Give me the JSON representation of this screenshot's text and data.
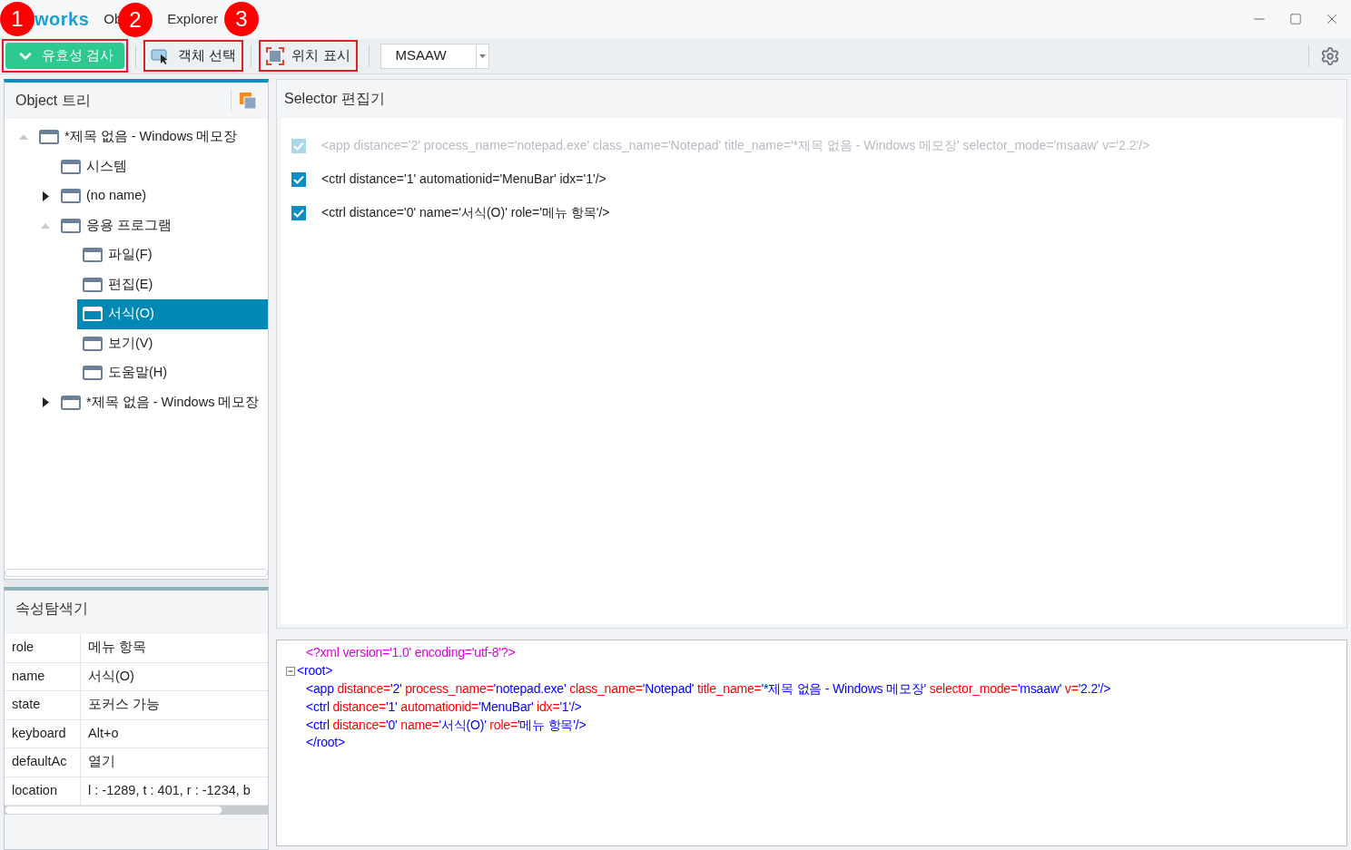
{
  "callouts": [
    "1",
    "2",
    "3"
  ],
  "titlebar": {
    "logo": "works",
    "title_parts": [
      "Ob",
      "Explorer"
    ]
  },
  "toolbar": {
    "validate_button": "유효성 검사",
    "select_button": "객체 선택",
    "locate_button": "위치 표시",
    "mode_dropdown": {
      "value": "MSAAW"
    }
  },
  "object_tree": {
    "title": "Object 트리",
    "items": [
      {
        "label": "*제목 없음 - Windows 메모장",
        "expanded": true,
        "selected": false,
        "children": [
          {
            "label": "시스템",
            "selected": false
          },
          {
            "label": "(no name)",
            "expanded": false,
            "selected": false
          },
          {
            "label": "응용 프로그램",
            "expanded": true,
            "selected": false,
            "children": [
              {
                "label": "파일(F)",
                "selected": false
              },
              {
                "label": "편집(E)",
                "selected": false
              },
              {
                "label": "서식(O)",
                "selected": true
              },
              {
                "label": "보기(V)",
                "selected": false
              },
              {
                "label": "도움말(H)",
                "selected": false
              }
            ]
          },
          {
            "label": "*제목 없음 - Windows 메모장",
            "expanded": false,
            "selected": false
          }
        ]
      }
    ]
  },
  "property_explorer": {
    "title": "속성탐색기",
    "rows": [
      {
        "name": "role",
        "value": "메뉴 항목"
      },
      {
        "name": "name",
        "value": "서식(O)"
      },
      {
        "name": "state",
        "value": "포커스 가능"
      },
      {
        "name": "keyboard",
        "value": "Alt+o"
      },
      {
        "name": "defaultAc",
        "value": "열기"
      },
      {
        "name": "location",
        "value": "l : -1289, t : 401, r : -1234, b"
      }
    ]
  },
  "selector_editor": {
    "title": "Selector 편집기",
    "lines": [
      {
        "text": "<app distance='2' process_name='notepad.exe' class_name='Notepad' title_name='*제목 없음 - Windows 메모장' selector_mode='msaaw' v='2.2'/>",
        "checked": true,
        "disabled": true
      },
      {
        "text": "<ctrl distance='1' automationid='MenuBar' idx='1'/>",
        "checked": true,
        "disabled": false
      },
      {
        "text": "<ctrl distance='0' name='서식(O)' role='메뉴 항목'/>",
        "checked": true,
        "disabled": false
      }
    ]
  },
  "xml_editor": {
    "lines": [
      {
        "kind": "plain",
        "segments": [
          {
            "kind": "pi",
            "text": "<?xml version='1.0' encoding='utf-8'?>"
          }
        ]
      },
      {
        "kind": "foldable",
        "segments": [
          {
            "kind": "tag",
            "text": "<root>"
          }
        ]
      },
      {
        "kind": "plain",
        "segments": [
          {
            "kind": "tag",
            "text": "<app "
          },
          {
            "kind": "attr",
            "text": "distance="
          },
          {
            "kind": "value",
            "text": "'2' "
          },
          {
            "kind": "attr",
            "text": "process_name="
          },
          {
            "kind": "value",
            "text": "'notepad.exe' "
          },
          {
            "kind": "attr",
            "text": "class_name="
          },
          {
            "kind": "value",
            "text": "'Notepad' "
          },
          {
            "kind": "attr",
            "text": "title_name="
          },
          {
            "kind": "value",
            "text": "'*제목 없음 - Windows 메모장' "
          },
          {
            "kind": "attr",
            "text": "selector_mode="
          },
          {
            "kind": "value",
            "text": "'msaaw' "
          },
          {
            "kind": "attr",
            "text": "v="
          },
          {
            "kind": "value",
            "text": "'2.2'/>"
          }
        ]
      },
      {
        "kind": "plain",
        "segments": [
          {
            "kind": "tag",
            "text": "<ctrl "
          },
          {
            "kind": "attr",
            "text": "distance="
          },
          {
            "kind": "value",
            "text": "'1' "
          },
          {
            "kind": "attr",
            "text": "automationid="
          },
          {
            "kind": "value",
            "text": "'MenuBar' "
          },
          {
            "kind": "attr",
            "text": "idx="
          },
          {
            "kind": "value",
            "text": "'1'/>"
          }
        ]
      },
      {
        "kind": "plain",
        "segments": [
          {
            "kind": "tag",
            "text": "<ctrl "
          },
          {
            "kind": "attr",
            "text": "distance="
          },
          {
            "kind": "value",
            "text": "'0' "
          },
          {
            "kind": "attr",
            "text": "name="
          },
          {
            "kind": "value",
            "text": "'서식(O)' "
          },
          {
            "kind": "attr",
            "text": "role="
          },
          {
            "kind": "value",
            "text": "'메뉴 항목'/>"
          }
        ]
      },
      {
        "kind": "plain",
        "segments": [
          {
            "kind": "tag",
            "text": "</root>"
          }
        ]
      }
    ]
  }
}
